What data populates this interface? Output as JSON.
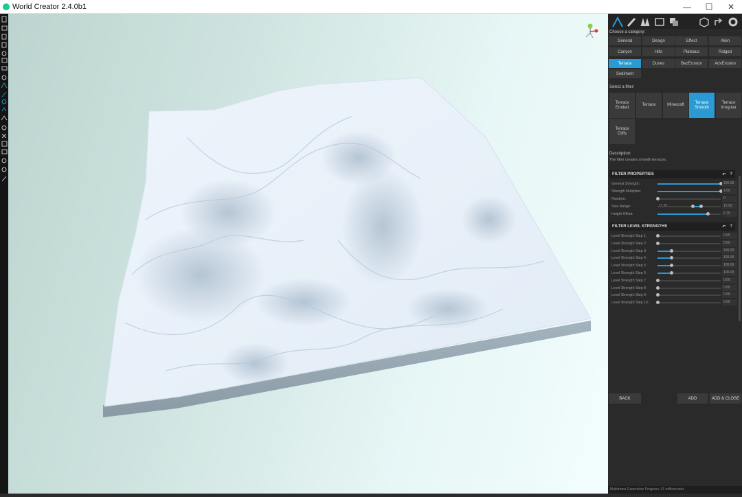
{
  "window": {
    "title": "World Creator 2.4.0b1",
    "minimize": "—",
    "maximize": "☐",
    "close": "✕"
  },
  "panel": {
    "category_label": "Choose a category:",
    "categories": [
      {
        "label": "General",
        "active": false
      },
      {
        "label": "Design",
        "active": false
      },
      {
        "label": "Effect",
        "active": false
      },
      {
        "label": "Alien",
        "active": false
      },
      {
        "label": "Canyon",
        "active": false
      },
      {
        "label": "Hills",
        "active": false
      },
      {
        "label": "Plateaus",
        "active": false
      },
      {
        "label": "Ridged",
        "active": false
      },
      {
        "label": "Terrace",
        "active": true
      },
      {
        "label": "Dunes",
        "active": false
      },
      {
        "label": "BezErosion",
        "active": false
      },
      {
        "label": "AdvErosion",
        "active": false
      },
      {
        "label": "Sediment",
        "active": false
      }
    ],
    "filter_label": "Select a filter:",
    "filters": [
      {
        "line1": "Terrace",
        "line2": "Eroded",
        "active": false
      },
      {
        "line1": "Terrace",
        "line2": "",
        "active": false
      },
      {
        "line1": "Minecraft",
        "line2": "",
        "active": false
      },
      {
        "line1": "Terrace",
        "line2": "Smooth",
        "active": true
      },
      {
        "line1": "Terrace",
        "line2": "Irregular",
        "active": false
      },
      {
        "line1": "Terrace",
        "line2": "Cliffs",
        "active": false
      }
    ],
    "description_label": "Description:",
    "description_text": "The filter creates smooth terraces.",
    "filter_properties": {
      "title": "FILTER PROPERTIES",
      "reset_icon": "↶",
      "help_icon": "?",
      "rows": [
        {
          "label": "General Strength:",
          "value": "100.00",
          "level": 1.0
        },
        {
          "label": "Strength Multiplier:",
          "value": "1.00",
          "level": 1.0
        },
        {
          "label": "Random:",
          "value": "0",
          "level": 0.0
        },
        {
          "label": "Size Range:",
          "min": "11.20",
          "value": "15.93",
          "low": 0.55,
          "high": 0.68
        },
        {
          "label": "Height Offset:",
          "value": "0.79",
          "level": 0.79
        }
      ]
    },
    "level_strengths": {
      "title": "FILTER LEVEL STRENGTHS",
      "reset_icon": "↶",
      "help_icon": "?",
      "rows": [
        {
          "label": "Level Strength Step 1:",
          "value": "0.00",
          "level": 0.0
        },
        {
          "label": "Level Strength Step 2:",
          "value": "0.00",
          "level": 0.0
        },
        {
          "label": "Level Strength Step 3:",
          "value": "100.00",
          "level": 0.22
        },
        {
          "label": "Level Strength Step 4:",
          "value": "100.00",
          "level": 0.22
        },
        {
          "label": "Level Strength Step 5:",
          "value": "100.00",
          "level": 0.22
        },
        {
          "label": "Level Strength Step 6:",
          "value": "100.00",
          "level": 0.22
        },
        {
          "label": "Level Strength Step 7:",
          "value": "0.00",
          "level": 0.0
        },
        {
          "label": "Level Strength Step 8:",
          "value": "0.00",
          "level": 0.0
        },
        {
          "label": "Level Strength Step 9:",
          "value": "0.00",
          "level": 0.0
        },
        {
          "label": "Level Strength Step 10:",
          "value": "0.00",
          "level": 0.0
        }
      ]
    },
    "buttons": {
      "back": "BACK",
      "add": "ADD",
      "add_close": "ADD & CLOSE"
    },
    "status": "Multiframe Generation Progress: 31 milliseconds"
  },
  "colors": {
    "accent": "#2a9ad4",
    "panel_bg": "#2a2a2a",
    "terrain": "#e6f0f8"
  }
}
